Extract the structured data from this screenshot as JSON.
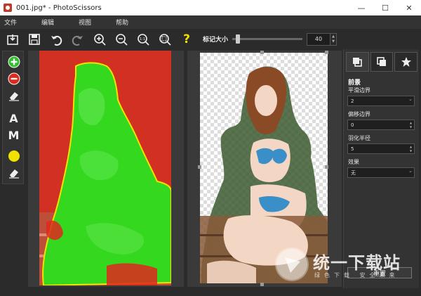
{
  "window": {
    "title": "001.jpg* - PhotoScissors",
    "minimize": "—",
    "maximize": "☐",
    "close": "✕"
  },
  "menu": {
    "items": [
      "文件",
      "编辑",
      "视图",
      "帮助"
    ]
  },
  "toolbar": {
    "buttons": [
      "open-icon",
      "save-icon",
      "undo-icon",
      "redo-icon",
      "zoom-in-icon",
      "zoom-out-icon",
      "actual-size-icon",
      "fit-icon",
      "help-icon"
    ],
    "help_label": "?",
    "actual_size_label": "1:1",
    "brush_size_label": "标记大小",
    "brush_size_value": "40",
    "brush_size_fraction": 0.05
  },
  "left_tools": {
    "items": [
      "add-foreground-icon",
      "remove-background-icon",
      "eraser-icon",
      "auto-mode",
      "manual-mode",
      "color-marker-icon",
      "eraser-icon"
    ],
    "auto_letter": "A",
    "manual_letter": "M"
  },
  "colors": {
    "foreground_mask": "#2ecc1e",
    "background_mask": "#e0281e",
    "accent_yellow": "#f2e200"
  },
  "right_panel": {
    "tabs": [
      "foreground-tab",
      "background-tab",
      "favorites-tab"
    ],
    "section_title": "前景",
    "fields": [
      {
        "label": "平滑边界",
        "value": "2",
        "control": "dropdown"
      },
      {
        "label": "偏移边界",
        "value": "0",
        "control": "spinner"
      },
      {
        "label": "羽化半径",
        "value": "5",
        "control": "spinner"
      },
      {
        "label": "效果",
        "value": "无",
        "control": "dropdown"
      }
    ],
    "reset_label": "重置"
  },
  "watermark": {
    "title": "统一下载站",
    "subtitle": "绿色下载  安全未来"
  }
}
